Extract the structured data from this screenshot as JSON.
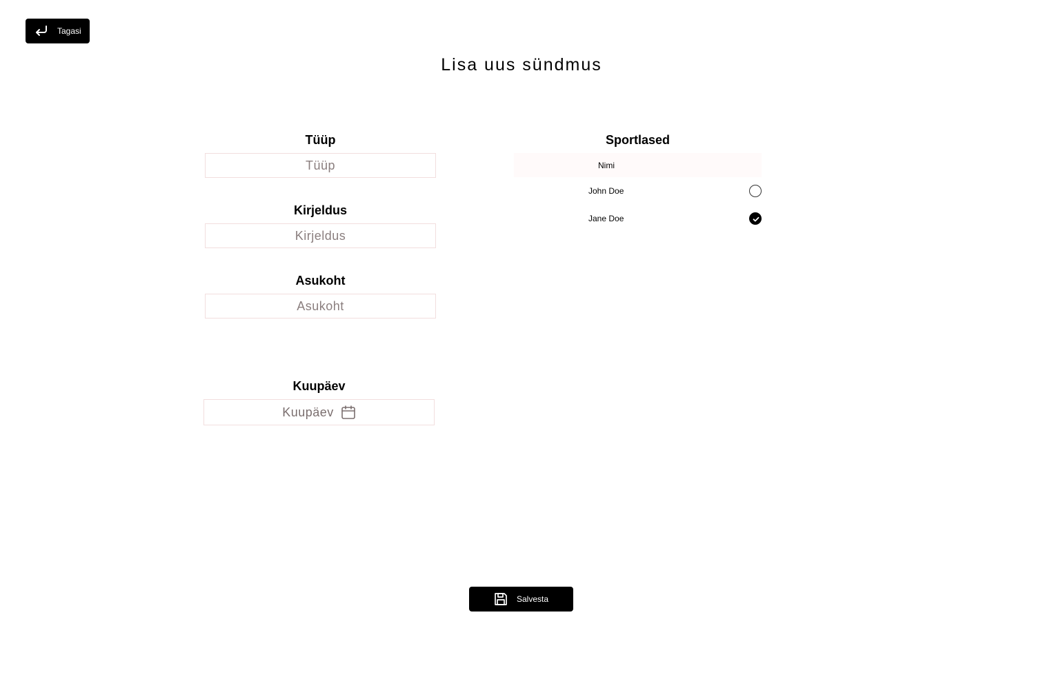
{
  "back_button": {
    "label": "Tagasi",
    "icon": "return-arrow-icon"
  },
  "page_title": "Lisa uus sündmus",
  "form": {
    "type": {
      "label": "Tüüp",
      "placeholder": "Tüüp",
      "value": ""
    },
    "description": {
      "label": "Kirjeldus",
      "placeholder": "Kirjeldus",
      "value": ""
    },
    "location": {
      "label": "Asukoht",
      "placeholder": "Asukoht",
      "value": ""
    },
    "date": {
      "label": "Kuupäev",
      "placeholder": "Kuupäev",
      "icon": "calendar-icon"
    }
  },
  "athletes": {
    "title": "Sportlased",
    "column_header": "Nimi",
    "rows": [
      {
        "name": "John Doe",
        "selected": false
      },
      {
        "name": "Jane Doe",
        "selected": true
      }
    ]
  },
  "save_button": {
    "label": "Salvesta",
    "icon": "save-icon"
  },
  "colors": {
    "button_bg": "#000000",
    "input_border": "#f2dede",
    "placeholder": "#8a7e7e",
    "table_header_bg": "#fffafa"
  }
}
